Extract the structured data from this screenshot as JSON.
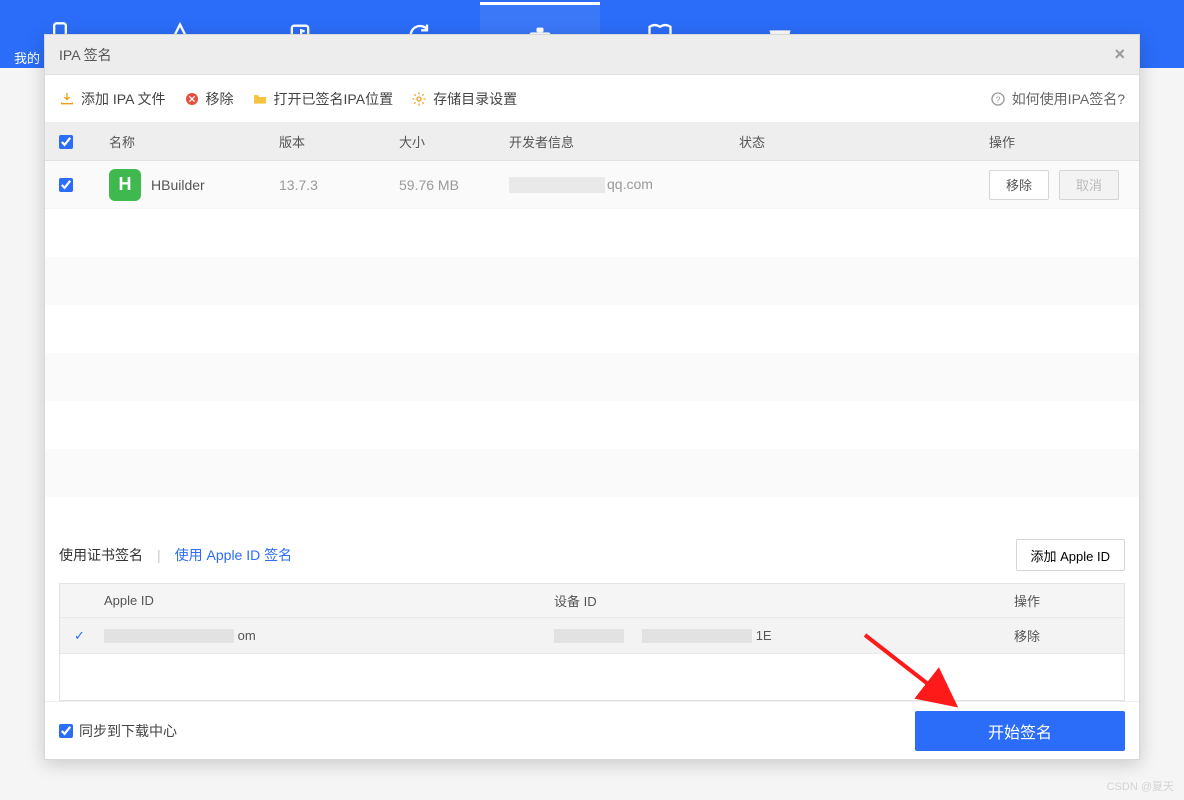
{
  "nav": {
    "sublabel": "我的"
  },
  "modal": {
    "title": "IPA 签名",
    "toolbar": {
      "add_ipa": "添加 IPA 文件",
      "remove": "移除",
      "open_signed": "打开已签名IPA位置",
      "storage": "存储目录设置",
      "help": "如何使用IPA签名?"
    },
    "columns": {
      "name": "名称",
      "version": "版本",
      "size": "大小",
      "dev": "开发者信息",
      "status": "状态",
      "action": "操作"
    },
    "rows": [
      {
        "checked": true,
        "app_initial": "H",
        "name": "HBuilder",
        "version": "13.7.3",
        "size": "59.76 MB",
        "dev_suffix": "qq.com",
        "status": "",
        "remove_label": "移除",
        "cancel_label": "取消",
        "cancel_disabled": true
      }
    ]
  },
  "sign": {
    "tab_cert": "使用证书签名",
    "tab_appleid": "使用 Apple ID 签名",
    "add_appleid": "添加 Apple ID",
    "columns": {
      "apple_id": "Apple ID",
      "device_id": "设备 ID",
      "action": "操作"
    },
    "rows": [
      {
        "selected": true,
        "apple_suffix": "om",
        "device_suffix": "1E",
        "remove_label": "移除"
      }
    ]
  },
  "footer": {
    "sync_label": "同步到下载中心",
    "sync_checked": true,
    "start_label": "开始签名"
  },
  "watermark": "CSDN @夏天"
}
